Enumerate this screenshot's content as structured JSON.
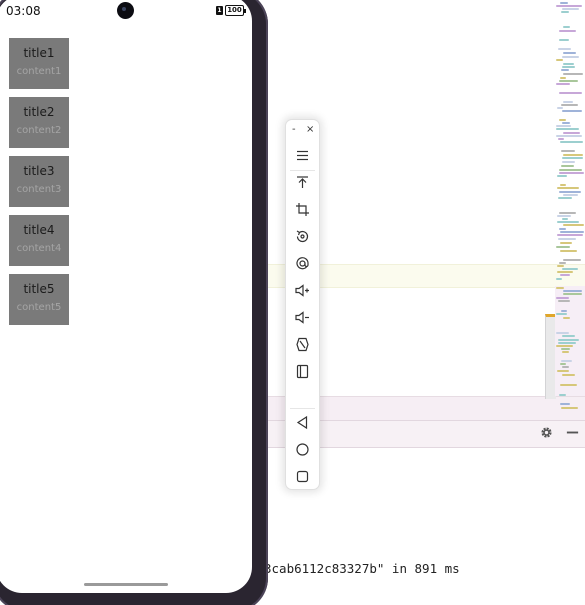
{
  "device": {
    "status_time": "03:08",
    "sim_label": "1",
    "battery_level": "100"
  },
  "cards": [
    {
      "title": "title1",
      "content": "content1"
    },
    {
      "title": "title2",
      "content": "content2"
    },
    {
      "title": "title3",
      "content": "content3"
    },
    {
      "title": "title4",
      "content": "content4"
    },
    {
      "title": "title5",
      "content": "content5"
    }
  ],
  "emulator_toolbar": {
    "minimize_label": "-",
    "close_label": "×",
    "tools": [
      {
        "icon": "menu-icon"
      },
      {
        "icon": "pin-to-top-icon"
      },
      {
        "icon": "crop-screenshot-icon"
      },
      {
        "icon": "rotate-icon"
      },
      {
        "icon": "location-icon"
      },
      {
        "icon": "volume-up-icon"
      },
      {
        "icon": "volume-down-icon"
      },
      {
        "icon": "shake-icon"
      },
      {
        "icon": "fold-icon"
      },
      {
        "icon": "back-icon"
      },
      {
        "icon": "home-icon"
      },
      {
        "icon": "recents-icon"
      }
    ]
  },
  "ide": {
    "console_line": "3cab6112c83327b\" in 891 ms",
    "settings_icon": "gear-icon",
    "hide_icon": "minus-icon"
  },
  "colors": {
    "card_bg": "#7a7a7a",
    "phone_frame": "#2a2530",
    "highlight_yellow": "#fbfbee",
    "highlight_pink": "#f6eef4"
  }
}
